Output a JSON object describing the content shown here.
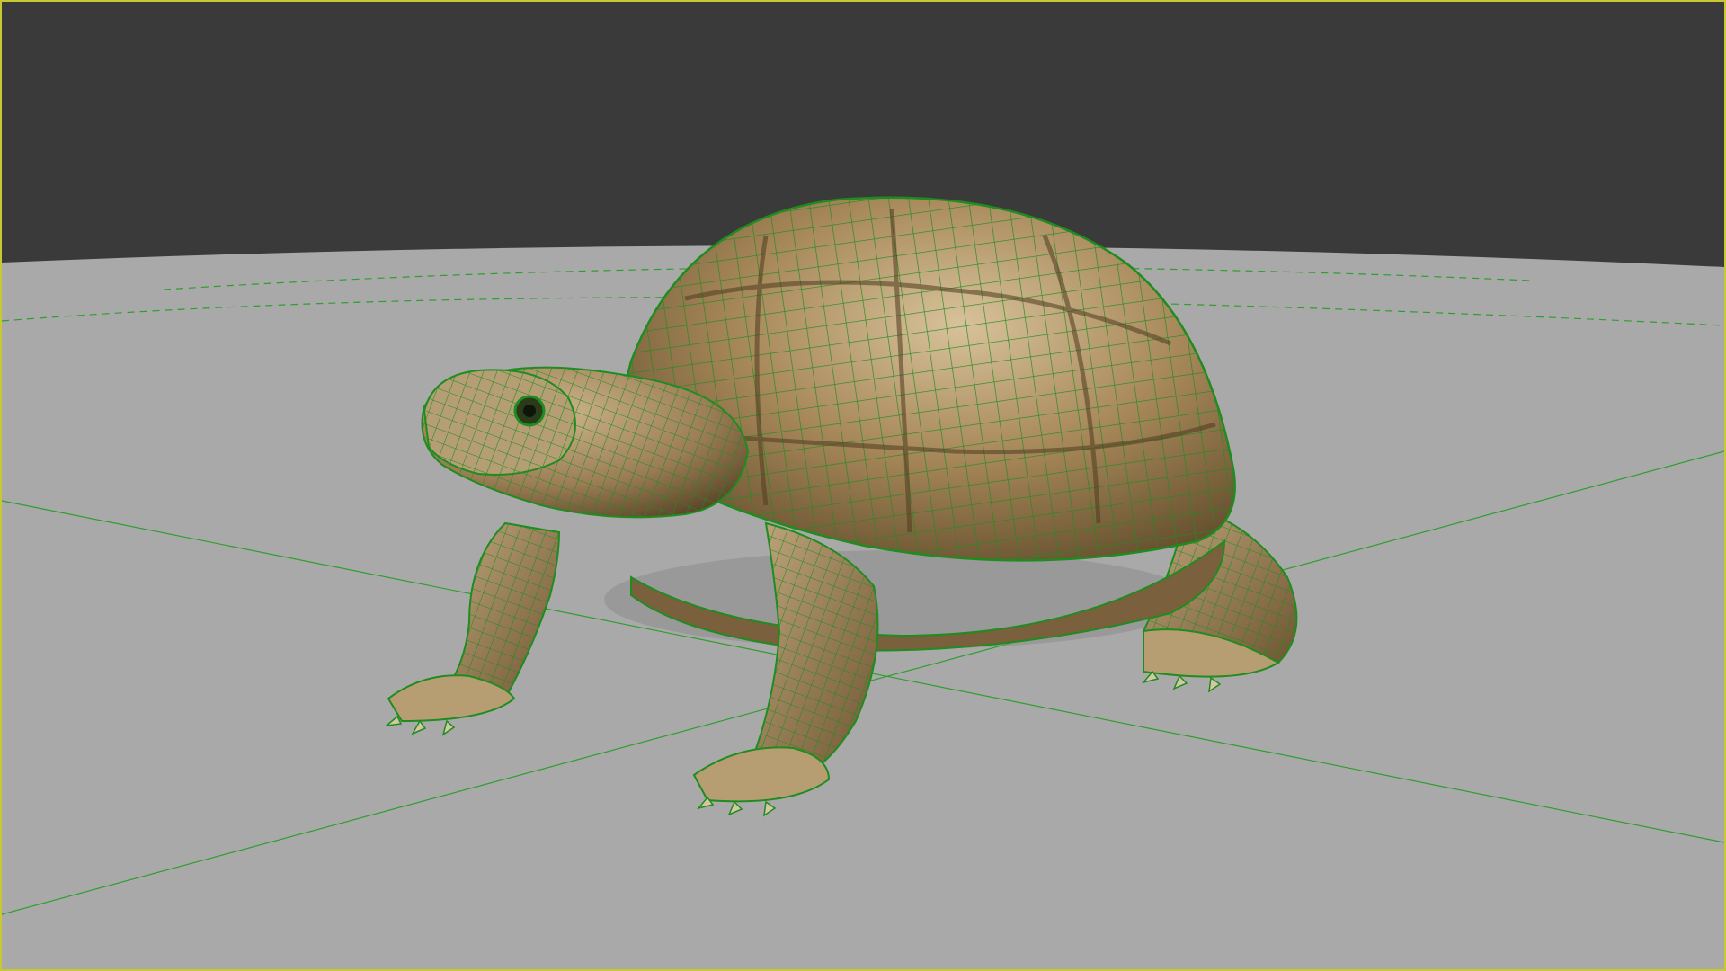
{
  "viewport": {
    "panel": "3d-viewport",
    "display_mode": "textured-with-wireframe-on-shaded",
    "selected_object": "turtle-mesh",
    "colors": {
      "frame_highlight": "#c8c832",
      "background": "#3a3a3a",
      "ground_plane": "#a9a9a9",
      "wireframe": "#1f8c1f",
      "grid_lines": "#2e9e2e",
      "skin": "#a88b62",
      "shell": "#9a7a52"
    }
  }
}
